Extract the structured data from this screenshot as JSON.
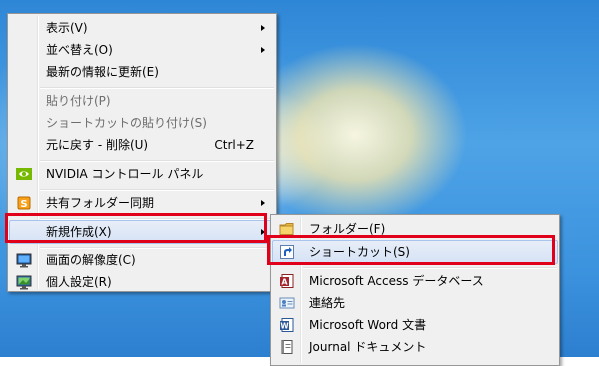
{
  "context_menu": {
    "items": [
      {
        "label": "表示(V)"
      },
      {
        "label": "並べ替え(O)"
      },
      {
        "label": "最新の情報に更新(E)"
      },
      {
        "label": "貼り付け(P)"
      },
      {
        "label": "ショートカットの貼り付け(S)"
      },
      {
        "label": "元に戻す - 削除(U)",
        "shortcut": "Ctrl+Z"
      },
      {
        "label": "NVIDIA コントロール パネル"
      },
      {
        "label": "共有フォルダー同期"
      },
      {
        "label": "新規作成(X)"
      },
      {
        "label": "画面の解像度(C)"
      },
      {
        "label": "個人設定(R)"
      }
    ]
  },
  "submenu": {
    "items": [
      {
        "label": "フォルダー(F)"
      },
      {
        "label": "ショートカット(S)"
      },
      {
        "label": "Microsoft Access データベース"
      },
      {
        "label": "連絡先"
      },
      {
        "label": "Microsoft Word 文書"
      },
      {
        "label": "Journal ドキュメント"
      }
    ]
  },
  "colors": {
    "highlight_border": "#e0001a",
    "menu_background": "#f0f0f0",
    "hover_background": "#d5e2f5"
  }
}
